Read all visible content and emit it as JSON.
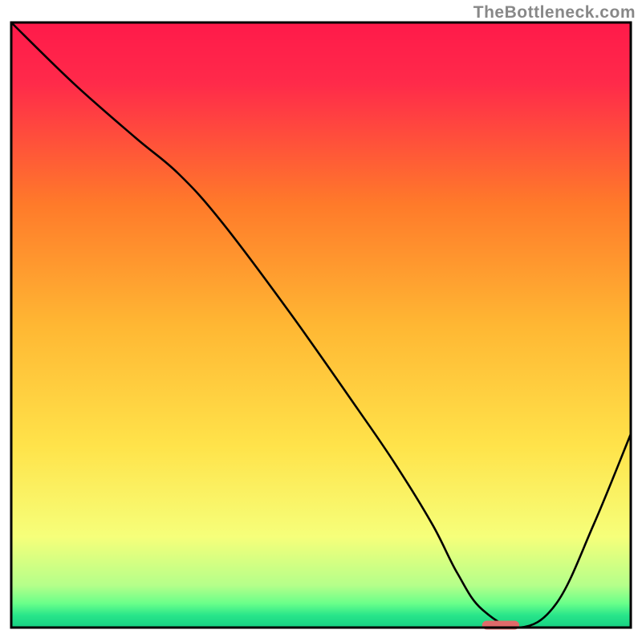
{
  "watermark": "TheBottleneck.com",
  "chart_data": {
    "type": "line",
    "title": "",
    "xlabel": "",
    "ylabel": "",
    "xlim": [
      0,
      100
    ],
    "ylim": [
      0,
      100
    ],
    "grid": false,
    "background_gradient": {
      "stops": [
        {
          "offset": 0,
          "color": "#ff1a4a"
        },
        {
          "offset": 10,
          "color": "#ff2a4a"
        },
        {
          "offset": 30,
          "color": "#ff7a2a"
        },
        {
          "offset": 50,
          "color": "#ffb733"
        },
        {
          "offset": 70,
          "color": "#ffe34a"
        },
        {
          "offset": 85,
          "color": "#f6ff7a"
        },
        {
          "offset": 93,
          "color": "#b5ff8a"
        },
        {
          "offset": 96,
          "color": "#6aff8a"
        },
        {
          "offset": 98,
          "color": "#28e58a"
        },
        {
          "offset": 100,
          "color": "#16cf82"
        }
      ]
    },
    "series": [
      {
        "name": "bottleneck-curve",
        "x": [
          0,
          10,
          20,
          27,
          34,
          45,
          56,
          62,
          68,
          72,
          76,
          82,
          88,
          94,
          100
        ],
        "y": [
          100,
          90,
          81,
          75,
          67,
          52,
          36,
          27,
          17,
          9,
          3,
          0,
          4,
          17,
          32
        ]
      }
    ],
    "marker": {
      "name": "optimal-range",
      "x_start": 76,
      "x_end": 82,
      "y": 0,
      "color": "#e06a6a"
    },
    "frame_color": "#000000",
    "line_color": "#000000",
    "line_width": 2.6
  }
}
